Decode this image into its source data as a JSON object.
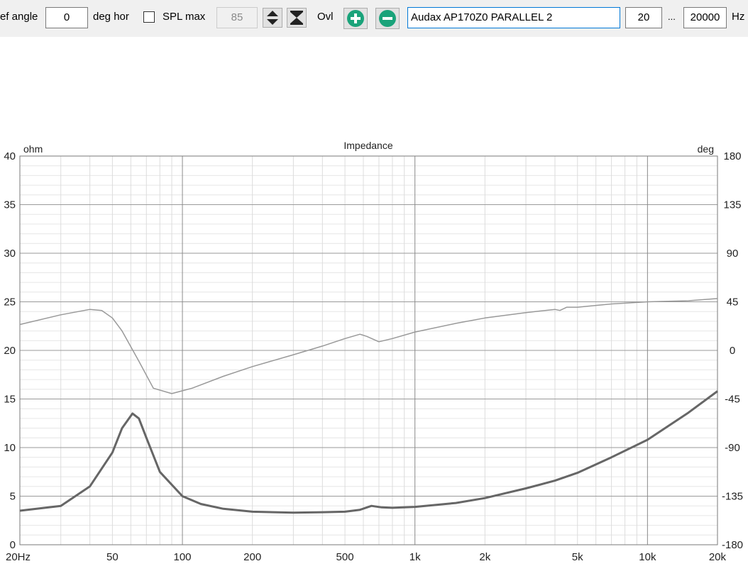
{
  "toolbar": {
    "ref_angle_label": "ef angle",
    "ref_angle_value": "0",
    "deg_hor_label": "deg hor",
    "spl_max_label": "SPL max",
    "spl_max_checked": false,
    "spl_max_value": "85",
    "ovl_label": "Ovl",
    "trace_name": "Audax AP170Z0 PARALLEL 2",
    "freq_min": "20",
    "ellipsis": "...",
    "freq_max": "20000",
    "hz_label": "Hz",
    "icons": [
      "up-down-arrows-icon",
      "collapse-arrows-icon",
      "plus-circle-icon",
      "minus-circle-icon"
    ],
    "accent_color": "#1aa37a"
  },
  "chart_data": {
    "type": "line",
    "title": "Impedance",
    "ylabel": "ohm",
    "y2label": "deg",
    "xscale": "log",
    "xlim": [
      20,
      20000
    ],
    "ylim": [
      0,
      40
    ],
    "y2lim": [
      -180,
      180
    ],
    "x_ticks": [
      20,
      50,
      100,
      200,
      500,
      1000,
      2000,
      5000,
      10000,
      20000
    ],
    "x_tick_labels": [
      "20Hz",
      "50",
      "100",
      "200",
      "500",
      "1k",
      "2k",
      "5k",
      "10k",
      "20k"
    ],
    "y_ticks": [
      0,
      5,
      10,
      15,
      20,
      25,
      30,
      35,
      40
    ],
    "y2_ticks": [
      -180,
      -135,
      -90,
      -45,
      0,
      45,
      90,
      135,
      180
    ],
    "grid": true,
    "series": [
      {
        "axis": "left",
        "color": "#666666",
        "points": [
          [
            20,
            3.5
          ],
          [
            30,
            4.0
          ],
          [
            40,
            6.0
          ],
          [
            50,
            9.5
          ],
          [
            55,
            12.0
          ],
          [
            61,
            13.5
          ],
          [
            65,
            13.0
          ],
          [
            70,
            11.0
          ],
          [
            80,
            7.5
          ],
          [
            100,
            5.0
          ],
          [
            120,
            4.2
          ],
          [
            150,
            3.7
          ],
          [
            200,
            3.4
          ],
          [
            300,
            3.3
          ],
          [
            400,
            3.35
          ],
          [
            500,
            3.4
          ],
          [
            580,
            3.6
          ],
          [
            650,
            4.0
          ],
          [
            720,
            3.85
          ],
          [
            800,
            3.8
          ],
          [
            1000,
            3.9
          ],
          [
            1500,
            4.3
          ],
          [
            2000,
            4.8
          ],
          [
            3000,
            5.8
          ],
          [
            4000,
            6.6
          ],
          [
            5000,
            7.4
          ],
          [
            7000,
            9.0
          ],
          [
            10000,
            10.8
          ],
          [
            15000,
            13.6
          ],
          [
            20000,
            15.8
          ]
        ]
      },
      {
        "axis": "right",
        "color": "#999999",
        "points": [
          [
            20,
            24
          ],
          [
            30,
            33
          ],
          [
            40,
            38
          ],
          [
            45,
            37
          ],
          [
            50,
            30
          ],
          [
            55,
            18
          ],
          [
            65,
            -10
          ],
          [
            75,
            -35
          ],
          [
            90,
            -40
          ],
          [
            110,
            -35
          ],
          [
            150,
            -24
          ],
          [
            200,
            -15
          ],
          [
            300,
            -4
          ],
          [
            400,
            4
          ],
          [
            500,
            11
          ],
          [
            580,
            15
          ],
          [
            620,
            13
          ],
          [
            700,
            8
          ],
          [
            800,
            11
          ],
          [
            1000,
            17
          ],
          [
            1500,
            25
          ],
          [
            2000,
            30
          ],
          [
            3000,
            35
          ],
          [
            4000,
            38
          ],
          [
            4200,
            37
          ],
          [
            4500,
            40
          ],
          [
            5000,
            40
          ],
          [
            7000,
            43
          ],
          [
            10000,
            45
          ],
          [
            15000,
            46
          ],
          [
            20000,
            48
          ]
        ]
      }
    ]
  }
}
